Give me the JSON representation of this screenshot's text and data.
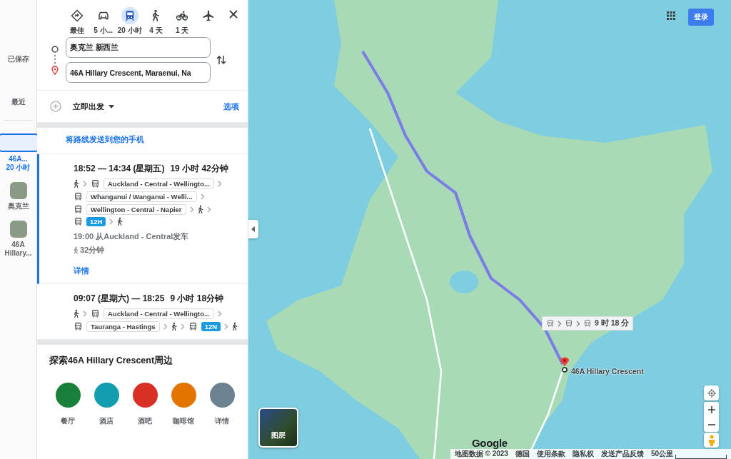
{
  "rail": {
    "links": [
      "已保存",
      "最近"
    ],
    "recent": [
      {
        "kind": "route",
        "label": "46A...",
        "sublabel": "20 小时",
        "selected": true
      },
      {
        "kind": "place",
        "label": "奥克兰",
        "selected": false
      },
      {
        "kind": "place",
        "label": "46A Hillary...",
        "selected": false
      }
    ]
  },
  "modes": [
    {
      "kind": "best",
      "label": "最佳",
      "selected": false
    },
    {
      "kind": "car",
      "label": "5 小...",
      "selected": false
    },
    {
      "kind": "transit",
      "label": "20 小时",
      "selected": true
    },
    {
      "kind": "walk",
      "label": "4 天",
      "selected": false
    },
    {
      "kind": "bike",
      "label": "1 天",
      "selected": false
    },
    {
      "kind": "plane",
      "selected": false
    }
  ],
  "origin": {
    "value": "奥克兰 新西兰"
  },
  "destination": {
    "value": "46A Hillary Crescent, Maraenui, Na"
  },
  "depart": {
    "label": "立即出发",
    "options": "选项"
  },
  "send_to_phone": "将路线发送到您的手机",
  "routes": [
    {
      "selected": true,
      "times": "18:52 — 14:34 (星期五)",
      "duration": "19 小时 42分钟",
      "steps": [
        {
          "kind": "walk"
        },
        {
          "kind": "bus",
          "line": "Auckland - Central - Wellingto..."
        },
        {
          "kind": "bus",
          "line": "Whanganui / Wanganui - Welli..."
        },
        {
          "kind": "bus",
          "line": "Wellington - Central - Napier"
        },
        {
          "kind": "walk"
        },
        {
          "kind": "bus",
          "badge": "12H"
        },
        {
          "kind": "walk"
        }
      ],
      "departure": "19:00 从Auckland - Central发车",
      "walk": "32分钟",
      "details": "详情"
    },
    {
      "selected": false,
      "times": "09:07 (星期六) — 18:25",
      "duration": "9 小时 18分钟",
      "steps": [
        {
          "kind": "walk"
        },
        {
          "kind": "bus",
          "line": "Auckland - Central - Wellingto..."
        },
        {
          "kind": "bus",
          "line": "Tauranga - Hastings"
        },
        {
          "kind": "walk"
        },
        {
          "kind": "bus",
          "badge": "12N"
        },
        {
          "kind": "walk"
        }
      ]
    }
  ],
  "explore": {
    "title": "探索46A Hillary Crescent周边",
    "categories": [
      {
        "label": "餐厅",
        "color": "#188038"
      },
      {
        "label": "酒店",
        "color": "#129eaf"
      },
      {
        "label": "酒吧",
        "color": "#d93025"
      },
      {
        "label": "咖啡馆",
        "color": "#e37400"
      },
      {
        "label": "详情",
        "color": "#6b8290"
      }
    ]
  },
  "map": {
    "sign_in": "登录",
    "route_label": {
      "steps": [
        {
          "kind": "bus"
        },
        {
          "kind": "bus"
        },
        {
          "kind": "bus"
        }
      ],
      "duration": "9 时 18 分"
    },
    "destination_label": "46A Hillary Crescent",
    "layers": "图层",
    "logo": "Google",
    "footer": [
      "地图数据 © 2023",
      "德国",
      "使用条款",
      "隐私权",
      "发送产品反馈"
    ],
    "scale": "50公里"
  }
}
